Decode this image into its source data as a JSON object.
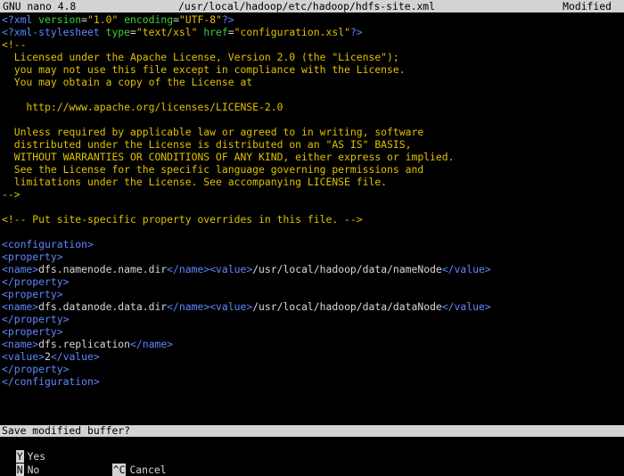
{
  "titlebar": {
    "app": "GNU nano 4.8",
    "file": "/usr/local/hadoop/etc/hadoop/hdfs-site.xml",
    "status": "Modified"
  },
  "editor": {
    "lines": [
      "<?xml version=\"1.0\" encoding=\"UTF-8\"?>",
      "<?xml-stylesheet type=\"text/xsl\" href=\"configuration.xsl\"?>",
      "<!--",
      "  Licensed under the Apache License, Version 2.0 (the \"License\");",
      "  you may not use this file except in compliance with the License.",
      "  You may obtain a copy of the License at",
      "",
      "    http://www.apache.org/licenses/LICENSE-2.0",
      "",
      "  Unless required by applicable law or agreed to in writing, software",
      "  distributed under the License is distributed on an \"AS IS\" BASIS,",
      "  WITHOUT WARRANTIES OR CONDITIONS OF ANY KIND, either express or implied.",
      "  See the License for the specific language governing permissions and",
      "  limitations under the License. See accompanying LICENSE file.",
      "-->",
      "",
      "<!-- Put site-specific property overrides in this file. -->",
      "",
      "<configuration>",
      "<property>",
      "<name>dfs.namenode.name.dir</name><value>/usr/local/hadoop/data/nameNode</value>",
      "</property>",
      "<property>",
      "<name>dfs.datanode.data.dir</name><value>/usr/local/hadoop/data/dataNode</value>",
      "</property>",
      "<property>",
      "<name>dfs.replication</name>",
      "<value>2</value>",
      "</property>",
      "</configuration>"
    ]
  },
  "prompt": {
    "text": "Save modified buffer?"
  },
  "options": [
    {
      "key": "Y",
      "label": "Yes"
    },
    {
      "key": "N",
      "label": "No"
    },
    {
      "key": "^C",
      "label": "Cancel"
    }
  ],
  "colors": {
    "bar_bg": "#d3d3d3",
    "xml_tag": "#5f87ff",
    "xml_attr": "#3cd23c",
    "comment": "#e0c000",
    "text": "#d8d8d8",
    "pi_decl": "#5fd7ff"
  }
}
